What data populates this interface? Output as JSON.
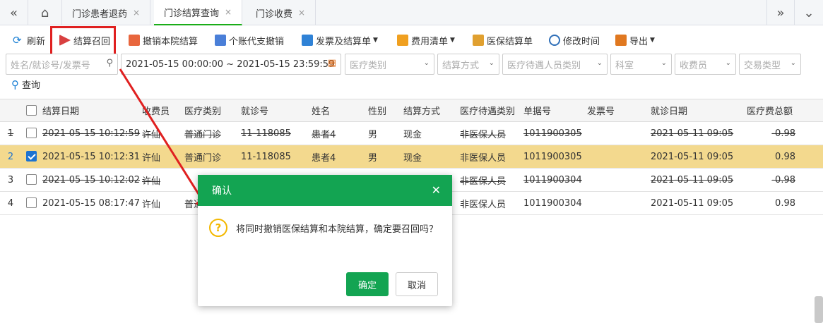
{
  "tabs": {
    "items": [
      {
        "label": "门诊患者退药"
      },
      {
        "label": "门诊结算查询"
      },
      {
        "label": "门诊收费"
      }
    ],
    "close_glyph": "×"
  },
  "toolbar": {
    "refresh": "刷新",
    "recall": "结算召回",
    "cancel_hospital": "撤销本院结算",
    "personal_account": "个账代支撤销",
    "invoice": "发票及结算单",
    "fee_list": "费用清单",
    "insurance_bill": "医保结算单",
    "modify_time": "修改时间",
    "export": "导出"
  },
  "filters": {
    "search_placeholder": "姓名/就诊号/发票号",
    "date_range": "2021-05-15 00:00:00 ~ 2021-05-15 23:59:59",
    "medical_type": "医疗类别",
    "settlement_method": "结算方式",
    "treatment_category": "医疗待遇人员类别",
    "department": "科室",
    "cashier": "收费员",
    "transaction_type": "交易类型",
    "query": "查询"
  },
  "table": {
    "headers": [
      "结算日期",
      "收费员",
      "医疗类别",
      "就诊号",
      "姓名",
      "性别",
      "结算方式",
      "医疗待遇类别",
      "单据号",
      "发票号",
      "就诊日期",
      "医疗费总额"
    ],
    "rows": [
      {
        "num": "1",
        "date": "2021-05-15 10:12:59",
        "cashier": "许仙",
        "type": "普通门诊",
        "visit": "11-118085",
        "name": "患者4",
        "sex": "男",
        "method": "现金",
        "category": "非医保人员",
        "doc": "1011900305",
        "invoice": "",
        "visit_date": "2021-05-11 09:05",
        "total": "-0.98"
      },
      {
        "num": "2",
        "date": "2021-05-15 10:12:31",
        "cashier": "许仙",
        "type": "普通门诊",
        "visit": "11-118085",
        "name": "患者4",
        "sex": "男",
        "method": "现金",
        "category": "非医保人员",
        "doc": "1011900305",
        "invoice": "",
        "visit_date": "2021-05-11 09:05",
        "total": "0.98"
      },
      {
        "num": "3",
        "date": "2021-05-15 10:12:02",
        "cashier": "许仙",
        "type": "",
        "visit": "",
        "name": "",
        "sex": "",
        "method": "",
        "category": "非医保人员",
        "doc": "1011900304",
        "invoice": "",
        "visit_date": "2021-05-11 09:05",
        "total": "-0.98"
      },
      {
        "num": "4",
        "date": "2021-05-15 08:17:47",
        "cashier": "许仙",
        "type": "普通",
        "visit": "",
        "name": "",
        "sex": "",
        "method": "",
        "category": "非医保人员",
        "doc": "1011900304",
        "invoice": "",
        "visit_date": "2021-05-11 09:05",
        "total": "0.98"
      }
    ]
  },
  "dialog": {
    "title": "确认",
    "message": "将同时撤销医保结算和本院结算，确定要召回吗？",
    "ok": "确定",
    "cancel": "取消"
  },
  "colors": {
    "accent_green": "#13a452",
    "highlight_red": "#e02020",
    "selected_row": "#f3d98e"
  }
}
